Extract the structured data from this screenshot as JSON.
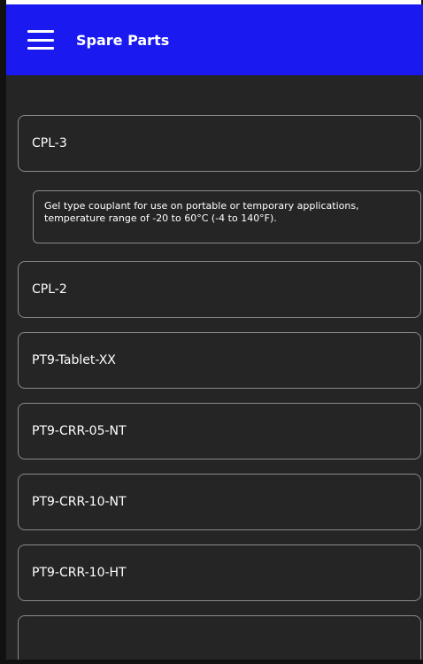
{
  "header": {
    "menu_icon": "hamburger-menu-icon",
    "title": "Spare Parts"
  },
  "parts": [
    {
      "label": "CPL-3"
    },
    {
      "label": "CPL-2"
    },
    {
      "label": "PT9-Tablet-XX"
    },
    {
      "label": "PT9-CRR-05-NT"
    },
    {
      "label": "PT9-CRR-10-NT"
    },
    {
      "label": "PT9-CRR-10-HT"
    },
    {
      "label": ""
    }
  ],
  "selected_description": "Gel type couplant for use on portable or temporary applications, temperature range of -20 to 60°C (-4 to 140°F).",
  "colors": {
    "header_bg": "#1a1af0",
    "screen_bg": "#252526",
    "border": "#8a8a8a",
    "text": "#ffffff"
  }
}
